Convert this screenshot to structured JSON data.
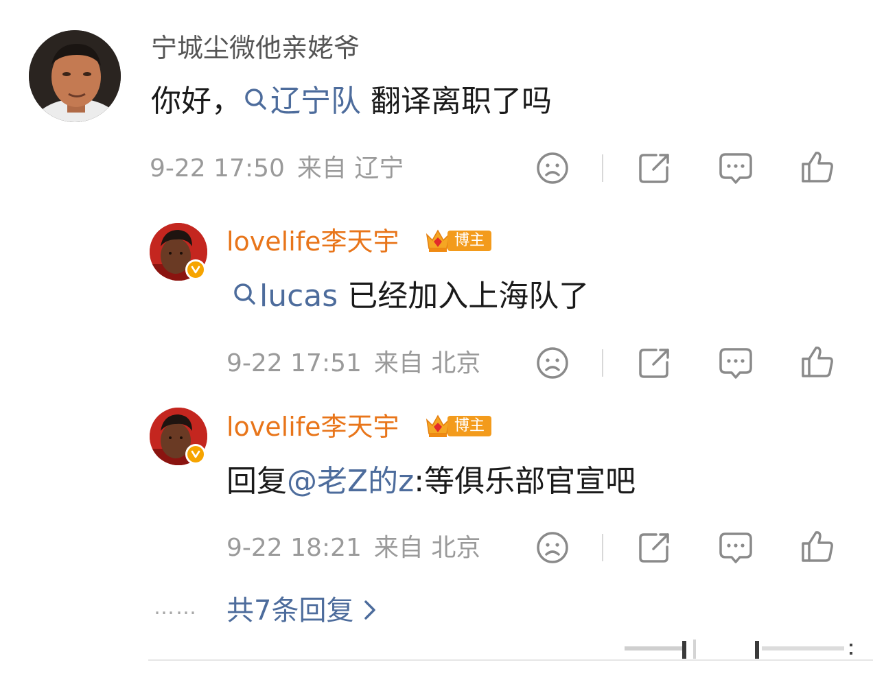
{
  "comments": [
    {
      "username": "宁城尘微他亲姥爷",
      "content_prefix": "你好，",
      "topic": "辽宁队",
      "content_suffix": " 翻译离职了吗",
      "date": "9-22 17:50",
      "source": "来自 辽宁"
    },
    {
      "username": "lovelife李天宇",
      "badge": "博主",
      "topic": "lucas",
      "content_suffix": " 已经加入上海队了",
      "date": "9-22 17:51",
      "source": "来自 北京"
    },
    {
      "username": "lovelife李天宇",
      "badge": "博主",
      "content_prefix": "回复",
      "mention": "@老Z的z",
      "content_suffix": ":等俱乐部官宣吧",
      "date": "9-22 18:21",
      "source": "来自 北京"
    }
  ],
  "more_replies": {
    "dots": "……",
    "label": "共7条回复"
  },
  "icons": {
    "dislike": "sad-face-icon",
    "share": "share-icon",
    "comment": "comment-icon",
    "like": "thumbs-up-icon"
  },
  "colors": {
    "link": "#4d6c9c",
    "username_orange": "#e8751a",
    "meta_gray": "#9a9a9a",
    "badge_orange": "#f39b1c"
  }
}
